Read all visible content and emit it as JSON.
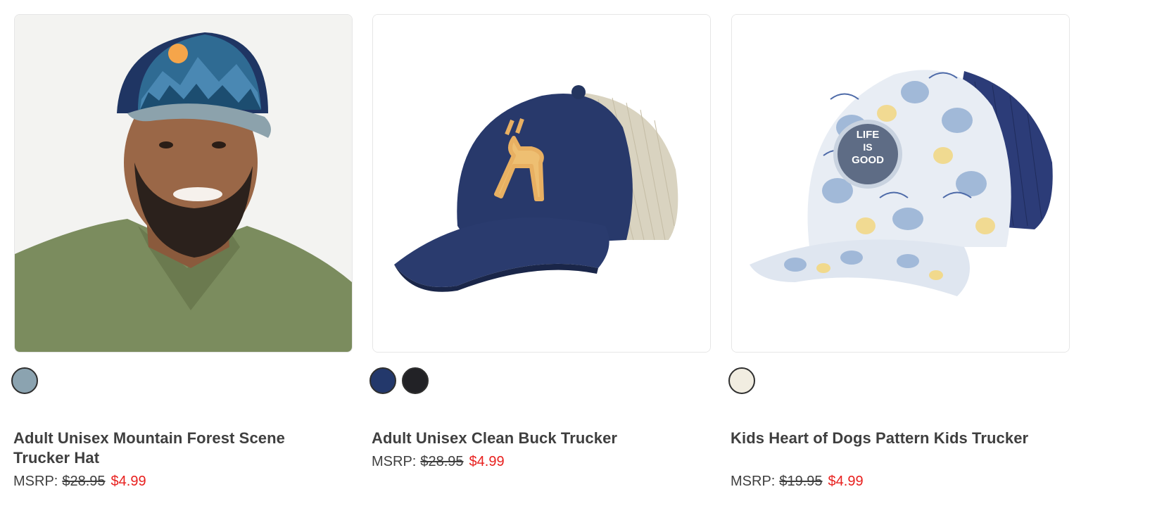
{
  "products": [
    {
      "title": "Adult Unisex Mountain Forest Scene Trucker Hat",
      "msrp_label": "MSRP:",
      "old_price": "$28.95",
      "sale_price": "$4.99",
      "swatches": [
        "#8ba3b0"
      ],
      "image": "man-wearing-blue-mountain-trucker-hat"
    },
    {
      "title": "Adult Unisex Clean Buck Trucker",
      "msrp_label": "MSRP:",
      "old_price": "$28.95",
      "sale_price": "$4.99",
      "swatches": [
        "#23386b",
        "#222226"
      ],
      "image": "navy-trucker-hat-with-deer"
    },
    {
      "title": "Kids Heart of Dogs Pattern Kids Trucker",
      "msrp_label": "MSRP:",
      "old_price": "$19.95",
      "sale_price": "$4.99",
      "swatches": [
        "#f1ede1"
      ],
      "image": "dog-pattern-kids-trucker-hat",
      "patch_text": [
        "LIFE",
        "IS",
        "GOOD"
      ]
    }
  ],
  "colors": {
    "sale": "#e8201e",
    "text": "#3f3f3f"
  }
}
